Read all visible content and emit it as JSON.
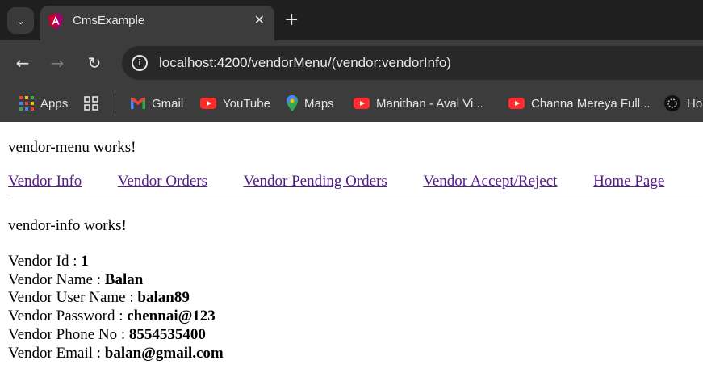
{
  "browser": {
    "tab_title": "CmsExample",
    "url": "localhost:4200/vendorMenu/(vendor:vendorInfo)",
    "bookmarks": [
      "Apps",
      "Gmail",
      "YouTube",
      "Maps",
      "Manithan - Aval Vi...",
      "Channa Mereya Full...",
      "Ho"
    ]
  },
  "page": {
    "menu_works": "vendor-menu works!",
    "nav_links": [
      "Vendor Info",
      "Vendor Orders",
      "Vendor Pending Orders",
      "Vendor Accept/Reject",
      "Home Page"
    ],
    "info_works": "vendor-info works!",
    "fields": [
      {
        "label": "Vendor Id : ",
        "value": "1"
      },
      {
        "label": "Vendor Name : ",
        "value": "Balan"
      },
      {
        "label": "Vendor User Name : ",
        "value": "balan89"
      },
      {
        "label": "Vendor Password : ",
        "value": "chennai@123"
      },
      {
        "label": "Vendor Phone No : ",
        "value": "8554535400"
      },
      {
        "label": "Vendor Email : ",
        "value": "balan@gmail.com"
      }
    ]
  },
  "colors": {
    "link": "#551a8b",
    "chrome_dark": "#1f1f1f",
    "chrome": "#3c3c3c"
  }
}
